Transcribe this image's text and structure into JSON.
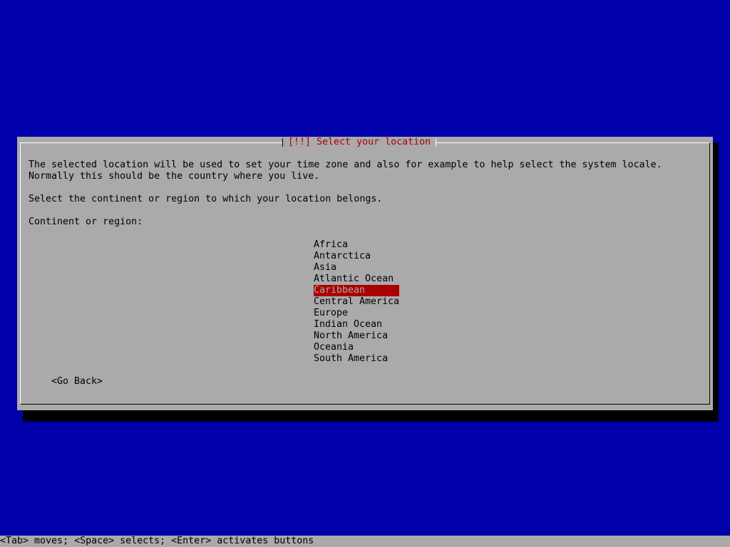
{
  "dialog": {
    "title": "[!!] Select your location",
    "description_line1": "The selected location will be used to set your time zone and also for example to help select the system locale.",
    "description_line2": "Normally this should be the country where you live.",
    "prompt": "Select the continent or region to which your location belongs.",
    "list_label": "Continent or region:",
    "regions": [
      "Africa",
      "Antarctica",
      "Asia",
      "Atlantic Ocean",
      "Caribbean",
      "Central America",
      "Europe",
      "Indian Ocean",
      "North America",
      "Oceania",
      "South America"
    ],
    "selected_region": "Caribbean",
    "go_back_label": "<Go Back>"
  },
  "help_bar": {
    "text": "<Tab> moves; <Space> selects; <Enter> activates buttons"
  },
  "colors": {
    "background": "#0000aa",
    "dialog": "#aaaaaa",
    "highlight": "#aa0000"
  }
}
